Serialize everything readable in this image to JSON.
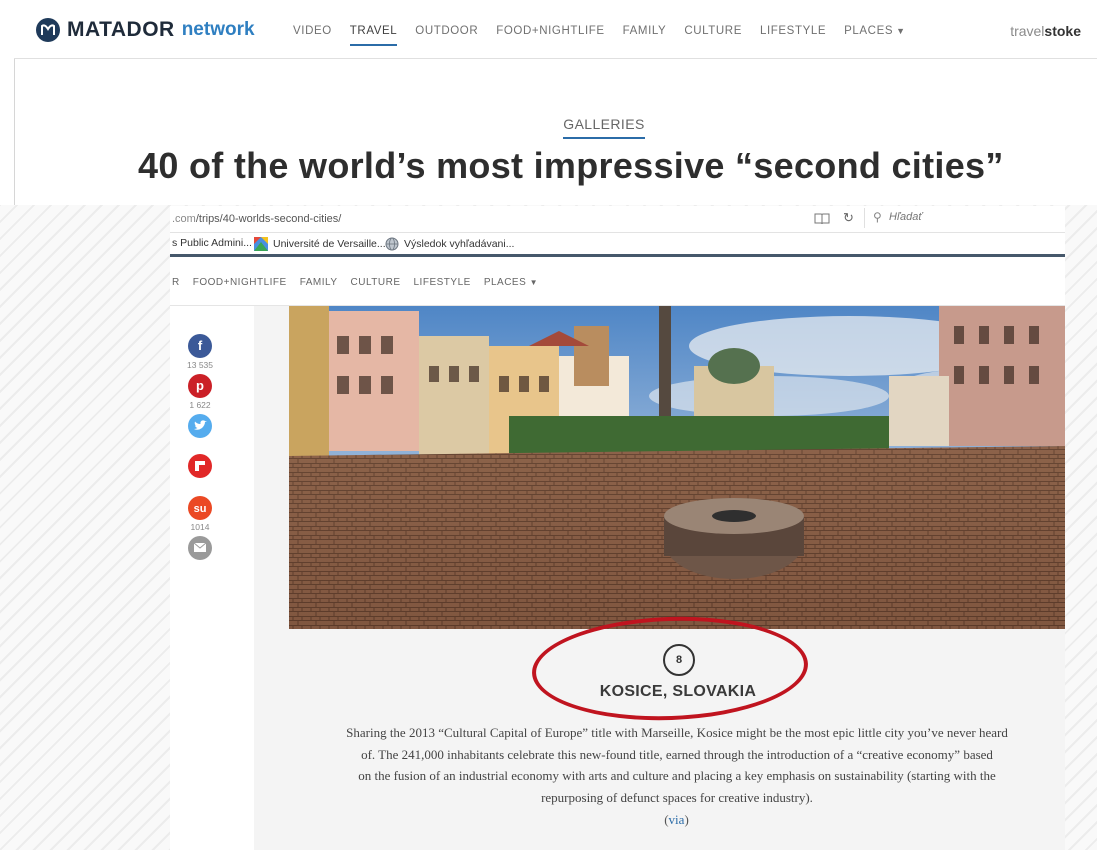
{
  "site": {
    "logo_brand": "MATADOR",
    "logo_suffix": "network",
    "nav": [
      "VIDEO",
      "TRAVEL",
      "OUTDOOR",
      "FOOD+NIGHTLIFE",
      "FAMILY",
      "CULTURE",
      "LIFESTYLE",
      "PLACES"
    ],
    "nav_active": "TRAVEL",
    "partner_light": "travel",
    "partner_bold": "stoke",
    "category": "GALLERIES",
    "headline": "40 of the world’s most impressive “second cities”"
  },
  "browser": {
    "url_dim": ".com",
    "url_path": "/trips/40-worlds-second-cities/",
    "search_placeholder": "Hľadať",
    "bookmarks": [
      "s Public Admini...",
      "Université de Versaille...",
      "Výsledok vyhľadávani..."
    ]
  },
  "page": {
    "subnav": [
      "R",
      "FOOD+NIGHTLIFE",
      "FAMILY",
      "CULTURE",
      "LIFESTYLE",
      "PLACES"
    ],
    "share": {
      "facebook_count": "13 535",
      "pinterest_count": "1 622",
      "stumbleupon_count": "1014"
    },
    "city_number": "8",
    "city_name": "KOSICE, SLOVAKIA",
    "description_lines": [
      "Sharing the 2013 “Cultural Capital of Europe” title with Marseille, Kosice might be the most epic little city you’ve never heard",
      "of. The 241,000 inhabitants celebrate this new-found title, earned through the introduction of a “creative economy” based",
      "on the fusion of an industrial economy with arts and culture and placing a key emphasis on sustainability (starting with the",
      "repurposing of defunct spaces for creative industry)."
    ],
    "via_label": "via"
  },
  "colors": {
    "accent_blue": "#2b6ca8",
    "annotation_red": "#c0141f",
    "facebook": "#3b5998",
    "pinterest": "#cb2027",
    "twitter": "#55acee",
    "flipboard": "#e12828",
    "stumbleupon": "#eb4924",
    "email": "#9a9a9a"
  }
}
